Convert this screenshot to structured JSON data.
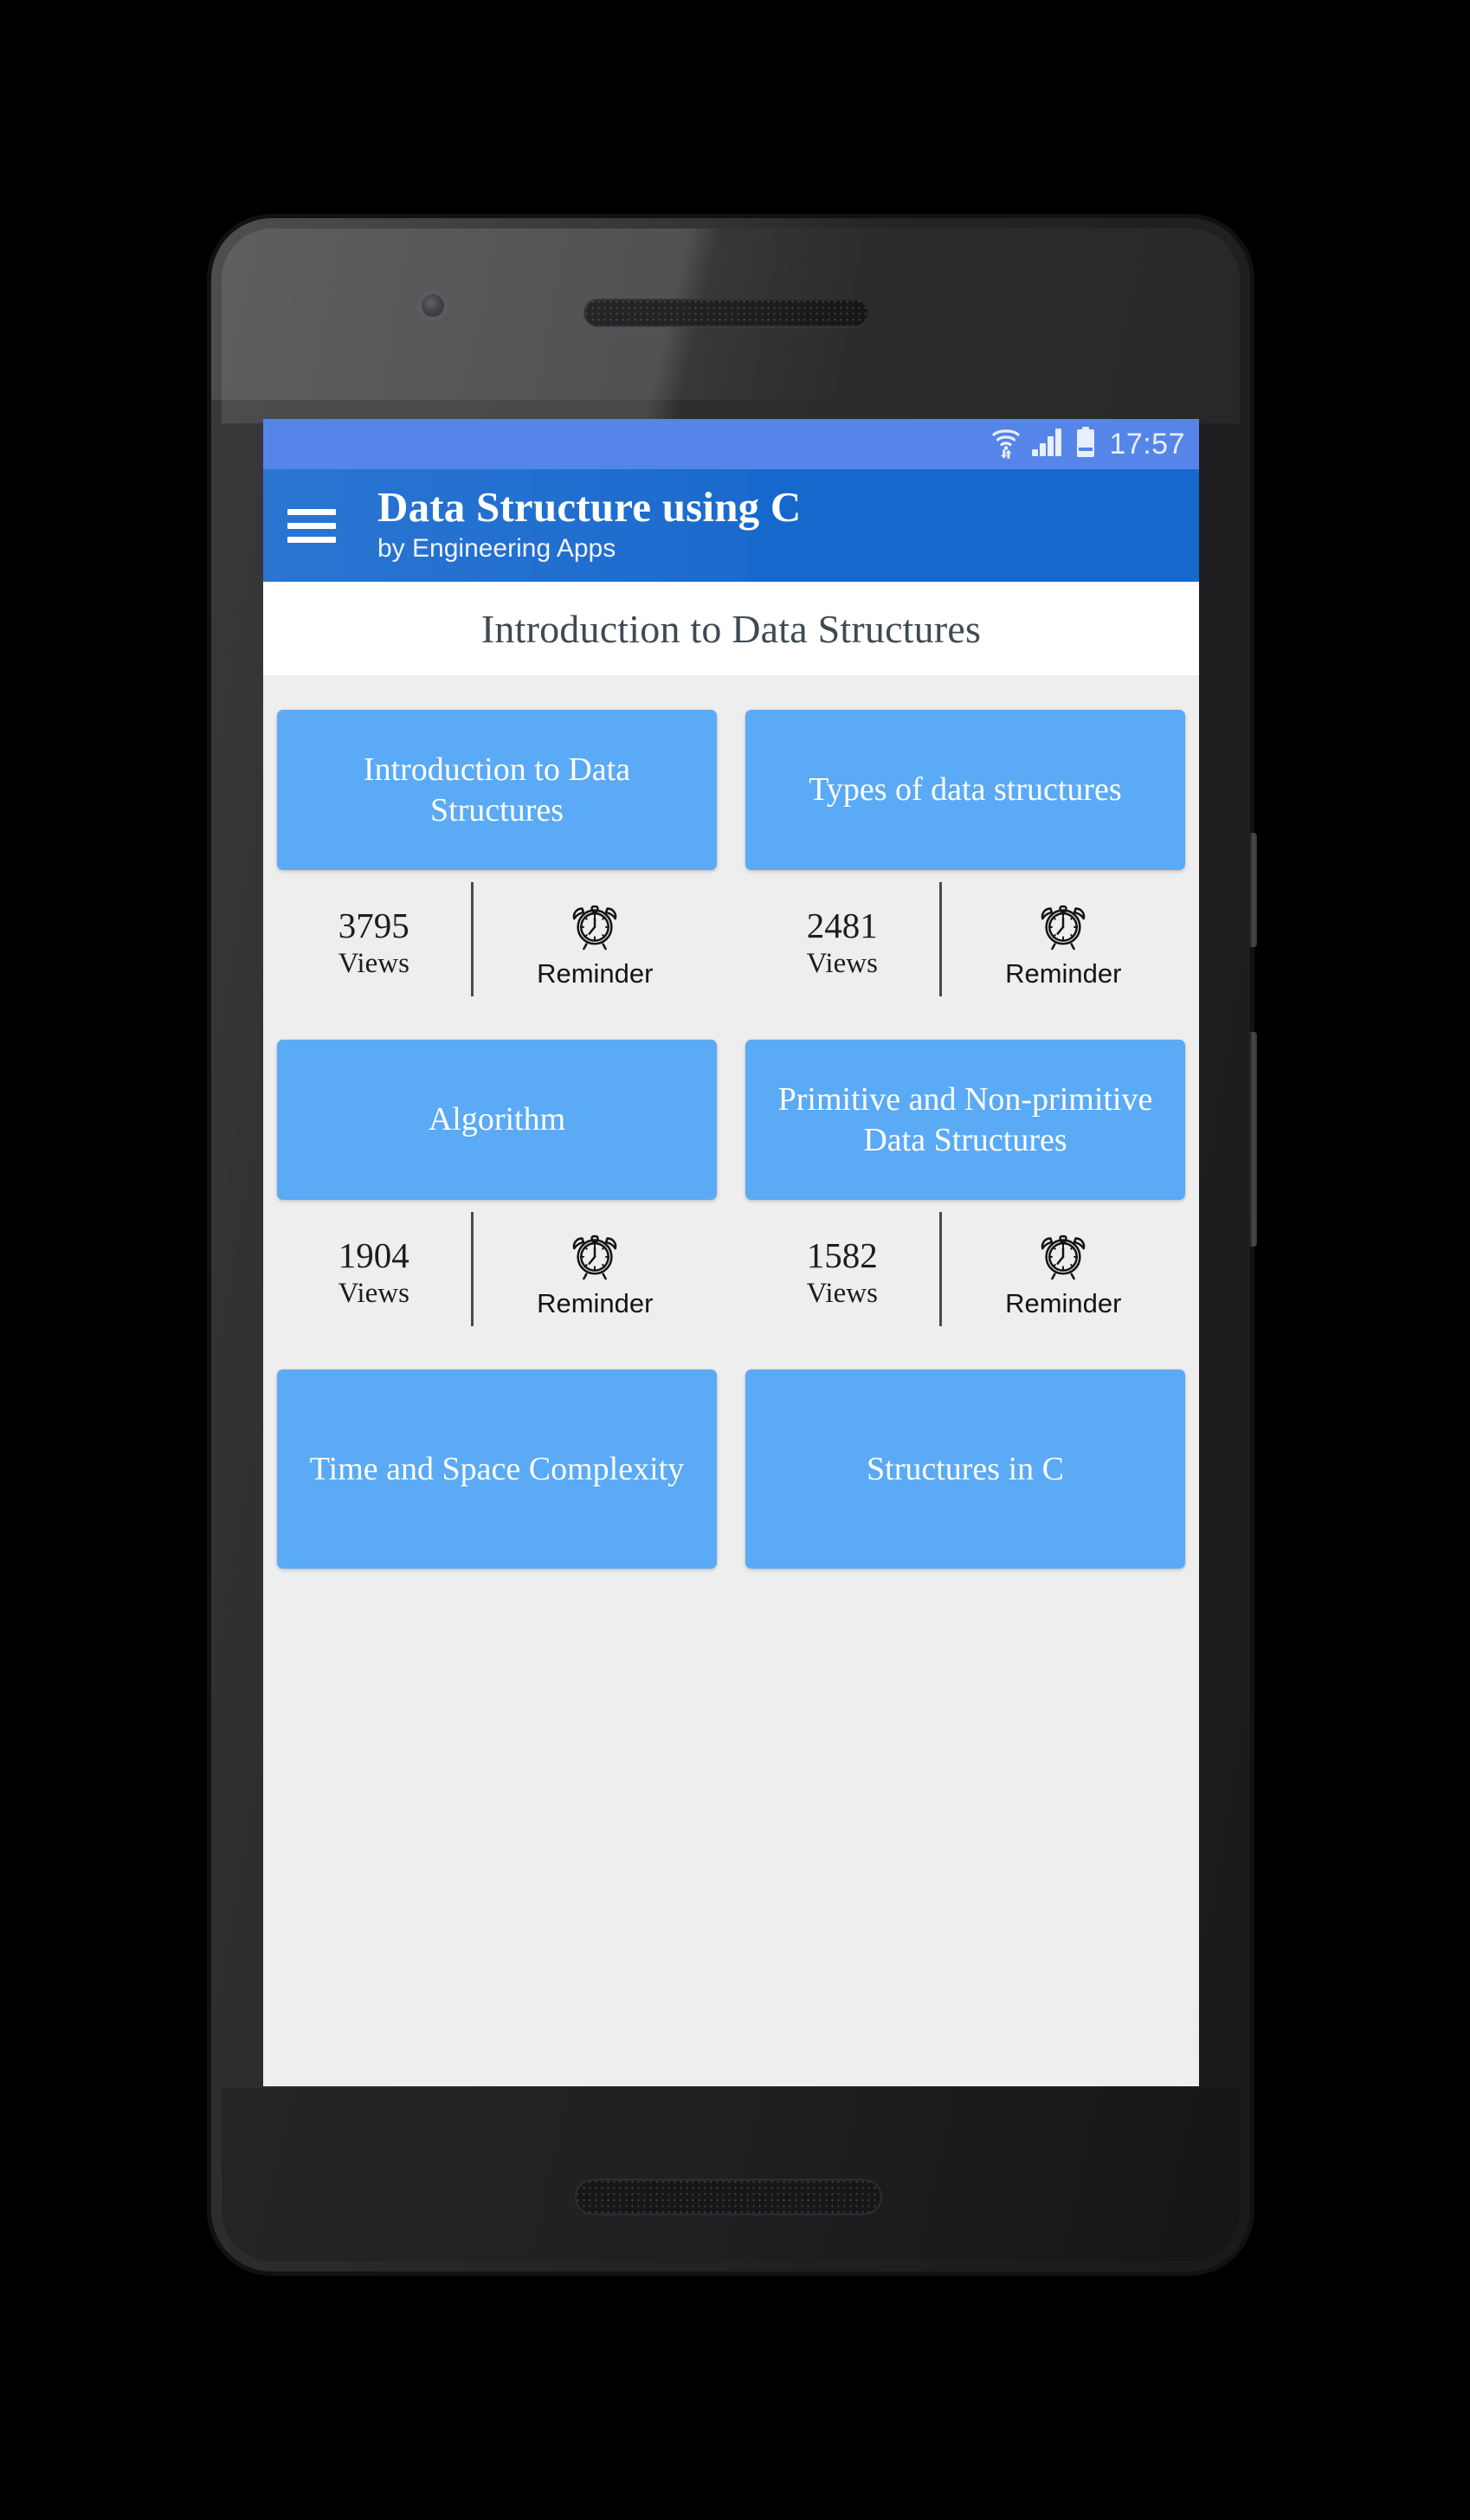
{
  "status_bar": {
    "time": "17:57",
    "icons": [
      "wifi-icon",
      "signal-icon",
      "battery-icon"
    ]
  },
  "app_bar": {
    "menu_icon": "hamburger-menu-icon",
    "title": "Data Structure using C",
    "subtitle": "by Engineering Apps"
  },
  "section": {
    "header": "Introduction to Data Structures"
  },
  "labels": {
    "views": "Views",
    "reminder": "Reminder",
    "reminder_icon": "alarm-clock-icon"
  },
  "topics": [
    {
      "title": "Introduction to Data Structures",
      "views": "3795"
    },
    {
      "title": "Types of data structures",
      "views": "2481"
    },
    {
      "title": "Algorithm",
      "views": "1904"
    },
    {
      "title": "Primitive and Non-primitive Data Structures",
      "views": "1582"
    },
    {
      "title": "Time and Space Complexity",
      "views": ""
    },
    {
      "title": "Structures in C",
      "views": ""
    }
  ],
  "colors": {
    "status_bar": "#5585e8",
    "app_bar": "#1668cd",
    "card": "#5aaaf5",
    "content_bg": "#eeeeee",
    "section_bg": "#ffffff",
    "text_dark": "#1d1d1d"
  }
}
